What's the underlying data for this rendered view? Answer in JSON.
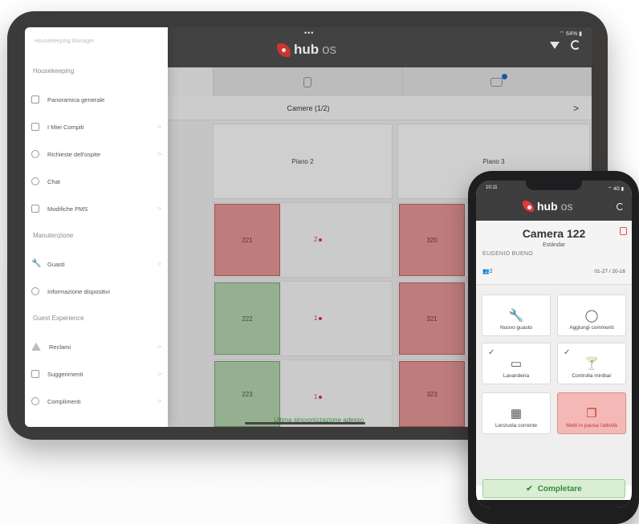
{
  "tablet": {
    "status_dots": "•••",
    "status_right": "⌔ 64% ▮",
    "logo_text": "hub",
    "logo_suffix": "os",
    "tabs": [
      {
        "name": "bed"
      },
      {
        "name": "bin"
      },
      {
        "name": "messages",
        "badge": true
      }
    ],
    "rooms_title": "Camere (1/2)",
    "rooms_arrow": ">",
    "floors": [
      "Piano 2",
      "Piano 3"
    ],
    "rooms": {
      "r221": "221",
      "r222": "222",
      "r223": "223",
      "r320": "320",
      "r321": "321",
      "r323": "323",
      "status_221": "2",
      "status_222": "1",
      "status_223": "1"
    },
    "sync_text": "Ultima sincronizzazione adesso"
  },
  "drawer": {
    "title": "Housekeeping Manager",
    "sections": {
      "housekeeping": "Housekeeping",
      "manutenzione": "Manutenzione",
      "guest": "Guest Experience"
    },
    "items": [
      {
        "label": "Panoramica generale",
        "icon": "grid-icon"
      },
      {
        "label": "I Miei Compiti",
        "icon": "checkbox-icon"
      },
      {
        "label": "Richieste dell'ospite",
        "icon": "person-icon"
      },
      {
        "label": "Chat",
        "icon": "chat-icon"
      },
      {
        "label": "Modifiche PMS",
        "icon": "document-icon"
      },
      {
        "label": "Guasti",
        "icon": "wrench-icon"
      },
      {
        "label": "Informazione dispositivi",
        "icon": "device-icon"
      },
      {
        "label": "Reclami",
        "icon": "warning-icon"
      },
      {
        "label": "Suggerimenti",
        "icon": "lightbulb-icon"
      },
      {
        "label": "Complimenti",
        "icon": "star-icon"
      }
    ],
    "chevron": ">"
  },
  "phone": {
    "status_time": "10:11",
    "status_right": "⌔ 4G ▮",
    "logo_text": "hub",
    "logo_suffix": "os",
    "room_title": "Camera 122",
    "room_type": "Estándar",
    "guest_name": "EUGENIO BUENO",
    "persons": "2",
    "dates": "01-27 / 20-16",
    "tiles": {
      "nuovo_guasto": "Nuovo guasto",
      "aggiungi_commenti": "Aggiungi commenti",
      "lavanderia": "Lavanderia",
      "controlla_minibar": "Controlla minibar",
      "lavoro_corrente": "Lenzuola corrente",
      "messa_in_pausa": "Metti in pausa l'attività"
    },
    "complete_label": "Completare"
  },
  "colors": {
    "accent_red": "#e53935",
    "room_red": "#d58b8b",
    "room_green": "#a6c4a2",
    "complete_green": "#3b8a3b"
  }
}
